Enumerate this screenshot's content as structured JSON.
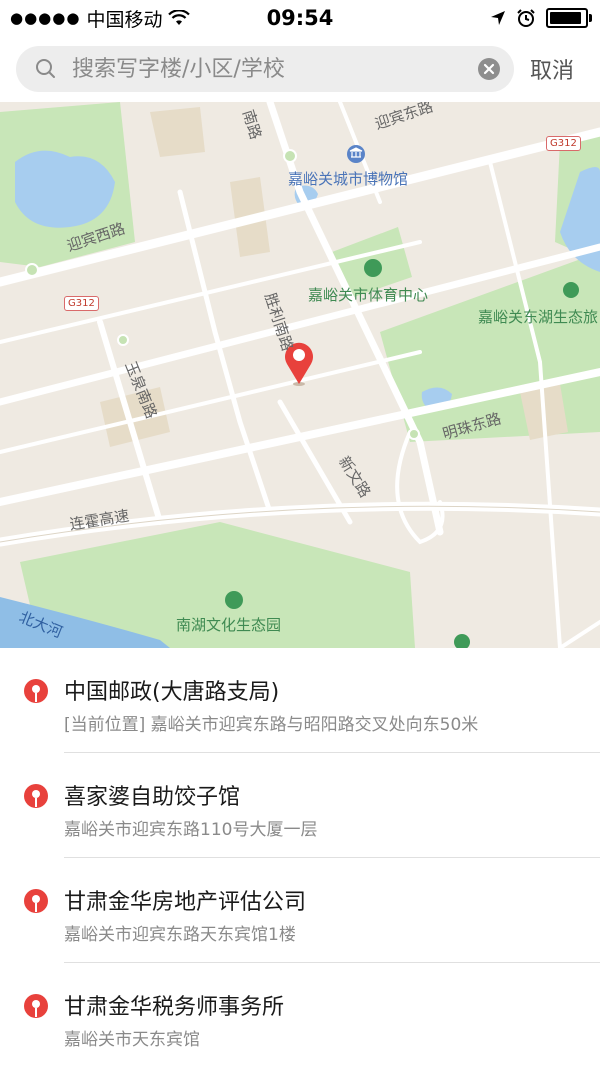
{
  "status_bar": {
    "signal": "●●●●●",
    "carrier": "中国移动",
    "time": "09:54",
    "battery_level": 0.9
  },
  "search": {
    "placeholder": "搜索写字楼/小区/学校",
    "cancel_label": "取消"
  },
  "map": {
    "roads": {
      "yingbin_xi": "迎宾西路",
      "yingbin_dong_top": "迎宾东路",
      "nan_top": "南路",
      "shengli_nan": "胜利南路",
      "yuquan_nan": "玉泉南路",
      "mingzhu_dong": "明珠东路",
      "xinwen": "新文路",
      "lianhuo": "连霍高速",
      "g312_a": "G312",
      "g312_b": "G312"
    },
    "pois": {
      "museum": "嘉峪关城市博物馆",
      "sports": "嘉峪关市体育中心",
      "east_lake": "嘉峪关东湖生态旅",
      "nanhu": "南湖文化生态园"
    },
    "water": {
      "beida_river": "北大河"
    }
  },
  "results": [
    {
      "title": "中国邮政(大唐路支局)",
      "address": "[当前位置] 嘉峪关市迎宾东路与昭阳路交叉处向东50米"
    },
    {
      "title": "喜家婆自助饺子馆",
      "address": "嘉峪关市迎宾东路110号大厦一层"
    },
    {
      "title": "甘肃金华房地产评估公司",
      "address": "嘉峪关市迎宾东路天东宾馆1楼"
    },
    {
      "title": "甘肃金华税务师事务所",
      "address": "嘉峪关市天东宾馆"
    }
  ],
  "colors": {
    "pin_red": "#e8413c",
    "park_green": "#c8e6b8",
    "water_blue": "#a7cdef",
    "map_bg": "#efeae2"
  }
}
